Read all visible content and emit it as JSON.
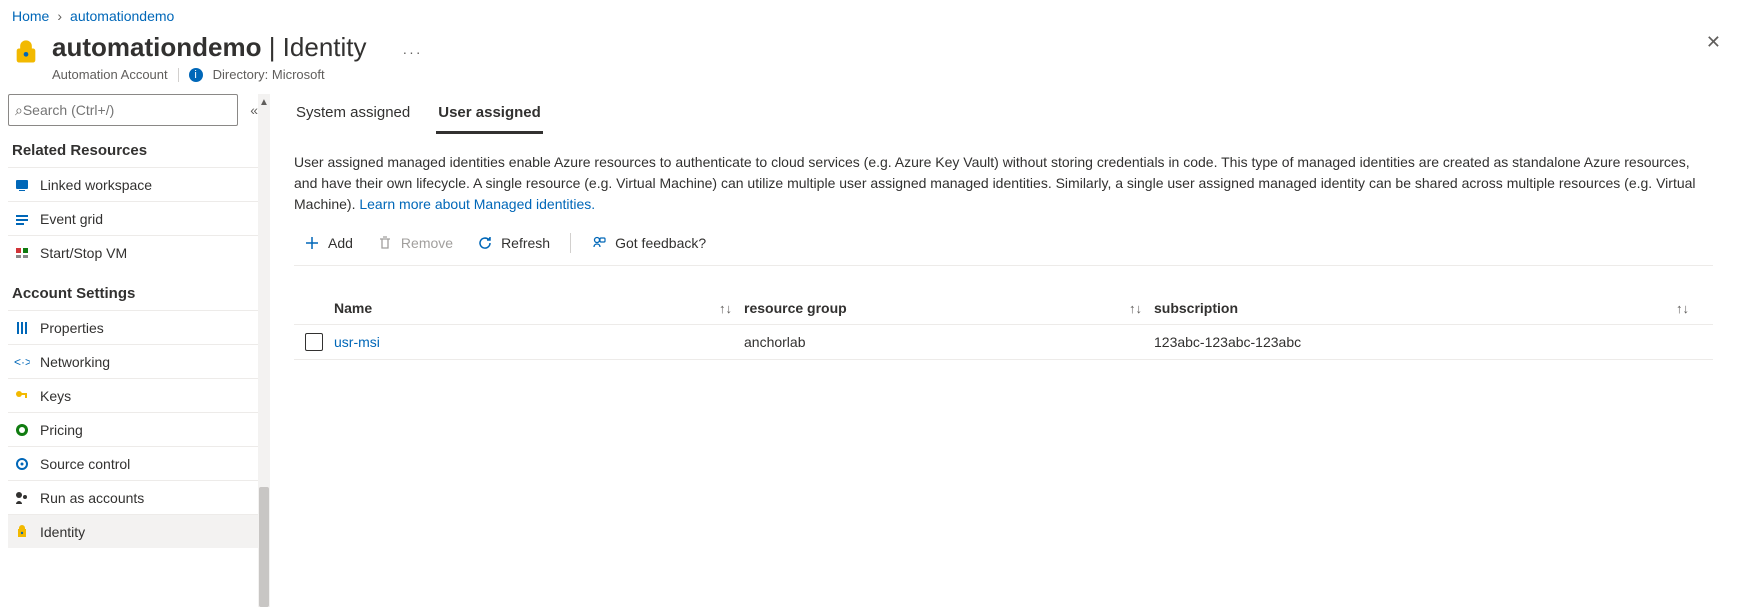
{
  "breadcrumb": {
    "home": "Home",
    "resource": "automationdemo"
  },
  "header": {
    "title_main": "automationdemo",
    "title_section": "Identity",
    "subtitle": "Automation Account",
    "directory_label": "Directory: Microsoft",
    "ellipsis": "···",
    "close": "✕"
  },
  "search": {
    "placeholder": "Search (Ctrl+/)"
  },
  "sidebar": {
    "section_related": "Related Resources",
    "related_items": [
      {
        "label": "Linked workspace",
        "icon_color": "#0067b8"
      },
      {
        "label": "Event grid",
        "icon_color": "#0067b8"
      },
      {
        "label": "Start/Stop VM",
        "icon_color": "#b14b18"
      }
    ],
    "section_settings": "Account Settings",
    "settings_items": [
      {
        "label": "Properties"
      },
      {
        "label": "Networking"
      },
      {
        "label": "Keys"
      },
      {
        "label": "Pricing"
      },
      {
        "label": "Source control"
      },
      {
        "label": "Run as accounts"
      },
      {
        "label": "Identity"
      }
    ]
  },
  "tabs": {
    "system": "System assigned",
    "user": "User assigned"
  },
  "description": {
    "text": "User assigned managed identities enable Azure resources to authenticate to cloud services (e.g. Azure Key Vault) without storing credentials in code. This type of managed identities are created as standalone Azure resources, and have their own lifecycle. A single resource (e.g. Virtual Machine) can utilize multiple user assigned managed identities. Similarly, a single user assigned managed identity can be shared across multiple resources (e.g. Virtual Machine). ",
    "link": "Learn more about Managed identities."
  },
  "toolbar": {
    "add": "Add",
    "remove": "Remove",
    "refresh": "Refresh",
    "feedback": "Got feedback?"
  },
  "table": {
    "headers": {
      "name": "Name",
      "rg": "resource group",
      "sub": "subscription"
    },
    "rows": [
      {
        "name": "usr-msi",
        "rg": "anchorlab",
        "sub": "123abc-123abc-123abc"
      }
    ]
  }
}
